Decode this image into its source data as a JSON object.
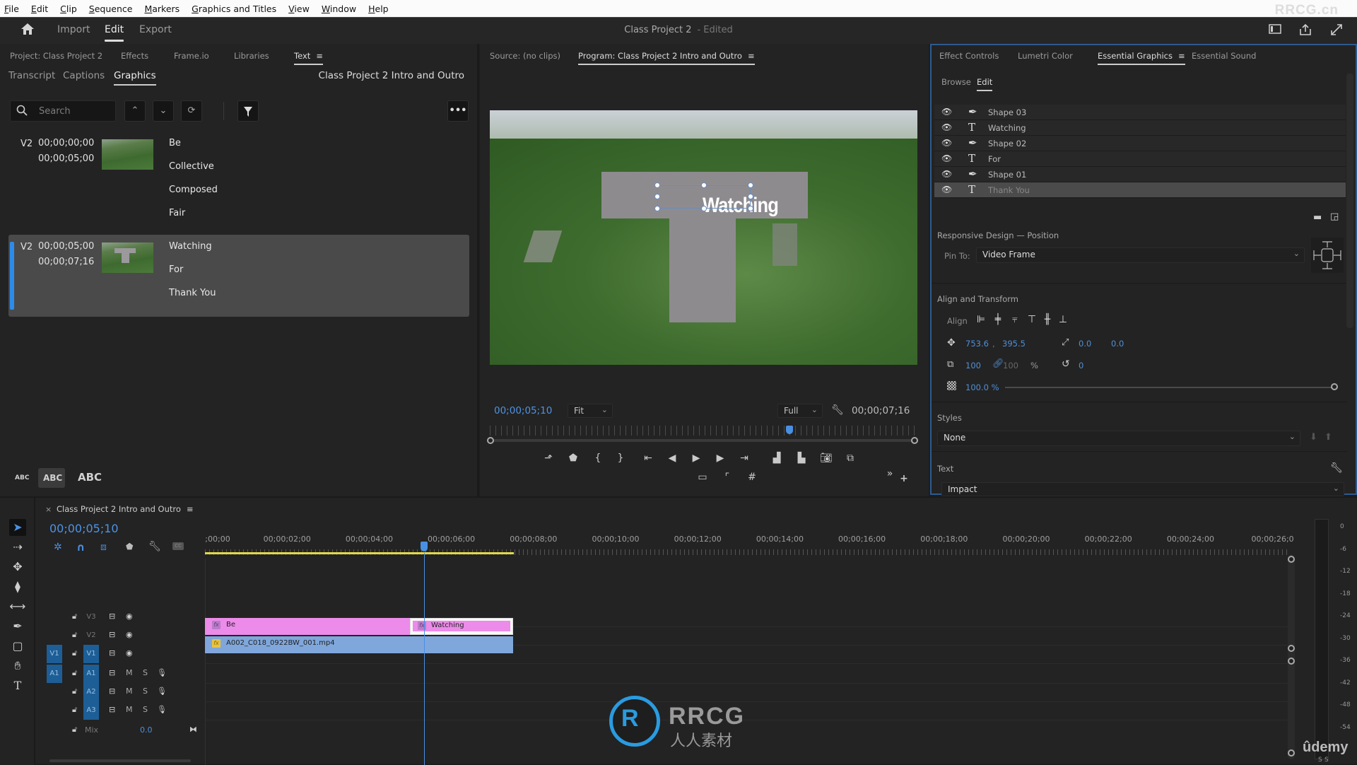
{
  "menubar": {
    "items": [
      "File",
      "Edit",
      "Clip",
      "Sequence",
      "Markers",
      "Graphics and Titles",
      "View",
      "Window",
      "Help"
    ],
    "watermark": "RRCG.cn"
  },
  "header": {
    "nav": [
      "Import",
      "Edit",
      "Export"
    ],
    "active_nav": "Edit",
    "project_title": "Class Project 2",
    "edited_label": "- Edited"
  },
  "left_panel": {
    "panel_tabs": [
      "Project: Class Project 2",
      "Effects",
      "Frame.io",
      "Libraries",
      "Text"
    ],
    "active_panel_tab": "Text",
    "sub_tabs": [
      "Transcript",
      "Captions",
      "Graphics"
    ],
    "active_sub_tab": "Graphics",
    "sequence_name": "Class Project 2 Intro and Outro",
    "search_placeholder": "Search",
    "graphics": [
      {
        "track": "V2",
        "in": "00;00;00;00",
        "out": "00;00;05;00",
        "texts": [
          "Be",
          "Collective",
          "Composed",
          "Fair"
        ],
        "selected": false
      },
      {
        "track": "V2",
        "in": "00;00;05;00",
        "out": "00;00;07;16",
        "texts": [
          "Watching",
          "For",
          "Thank You"
        ],
        "selected": true
      }
    ],
    "text_size_labels": [
      "ABC",
      "ABC",
      "ABC"
    ]
  },
  "monitor": {
    "source_tab": "Source: (no clips)",
    "program_tab": "Program: Class Project 2 Intro and Outro",
    "overlay_text": "Watching",
    "current_timecode": "00;00;05;10",
    "zoom_select": "Fit",
    "resolution_select": "Full",
    "duration_timecode": "00;00;07;16",
    "playhead_fraction": 0.7
  },
  "essential_graphics": {
    "panel_tabs": [
      "Effect Controls",
      "Lumetri Color",
      "Essential Graphics",
      "Essential Sound"
    ],
    "active_panel_tab": "Essential Graphics",
    "mode_tabs": [
      "Browse",
      "Edit"
    ],
    "active_mode": "Edit",
    "layers": [
      {
        "name": "Shape 03",
        "type": "shape",
        "selected": false
      },
      {
        "name": "Watching",
        "type": "text",
        "selected": false
      },
      {
        "name": "Shape 02",
        "type": "shape",
        "selected": false
      },
      {
        "name": "For",
        "type": "text",
        "selected": false
      },
      {
        "name": "Shape 01",
        "type": "shape",
        "selected": false
      },
      {
        "name": "Thank You",
        "type": "text",
        "selected": true
      }
    ],
    "responsive_title": "Responsive Design — Position",
    "pin_to_label": "Pin To:",
    "pin_to_value": "Video Frame",
    "align_transform_title": "Align and Transform",
    "align_label": "Align",
    "position_x": "753.6",
    "position_y": "395.5",
    "anchor_x": "0.0",
    "anchor_y": "0.0",
    "scale": "100",
    "scale_linked": "100",
    "scale_unit": "%",
    "rotation": "0",
    "opacity": "100.0 %",
    "opacity_fraction": 1.0,
    "styles_title": "Styles",
    "style_value": "None",
    "text_title": "Text",
    "font_value": "Impact"
  },
  "timeline": {
    "sequence_tab": "Class Project 2 Intro and Outro",
    "current_timecode": "00;00;05;10",
    "ruler_labels": [
      ";00;00",
      "00;00;02;00",
      "00;00;04;00",
      "00;00;06;00",
      "00;00;08;00",
      "00;00;10;00",
      "00;00;12;00",
      "00;00;14;00",
      "00;00;16;00",
      "00;00;18;00",
      "00;00;20;00",
      "00;00;22;00",
      "00;00;24;00",
      "00;00;26;0"
    ],
    "video_tracks": [
      "V3",
      "V2",
      "V1"
    ],
    "audio_tracks": [
      "A1",
      "A2",
      "A3"
    ],
    "source_patch_video": "V1",
    "source_patch_audio": "A1",
    "mute_label": "M",
    "solo_label": "S",
    "mix_label": "Mix",
    "mix_value": "0.0",
    "clips": [
      {
        "track": "V2",
        "name": "Be",
        "color": "#ec8be9"
      },
      {
        "track": "V2",
        "name": "Watching",
        "color": "#ec8be9"
      },
      {
        "track": "V1",
        "name": "A002_C018_0922BW_001.mp4",
        "color": "#7fa7dc"
      }
    ],
    "meter_labels": [
      "0",
      "-6",
      "-12",
      "-18",
      "-24",
      "-30",
      "-36",
      "-42",
      "-48",
      "-54"
    ],
    "meter_solo": [
      "S",
      "S"
    ]
  },
  "watermarks": {
    "logo_text": "RRCG",
    "logo_sub": "人人素材",
    "udemy": "ûdemy"
  },
  "colors": {
    "accent_blue": "#2d8ceb",
    "timecode_blue": "#4d93e4",
    "graphic_clip": "#ec8be9",
    "video_clip": "#7fa7dc",
    "work_area": "#e3d84a"
  }
}
